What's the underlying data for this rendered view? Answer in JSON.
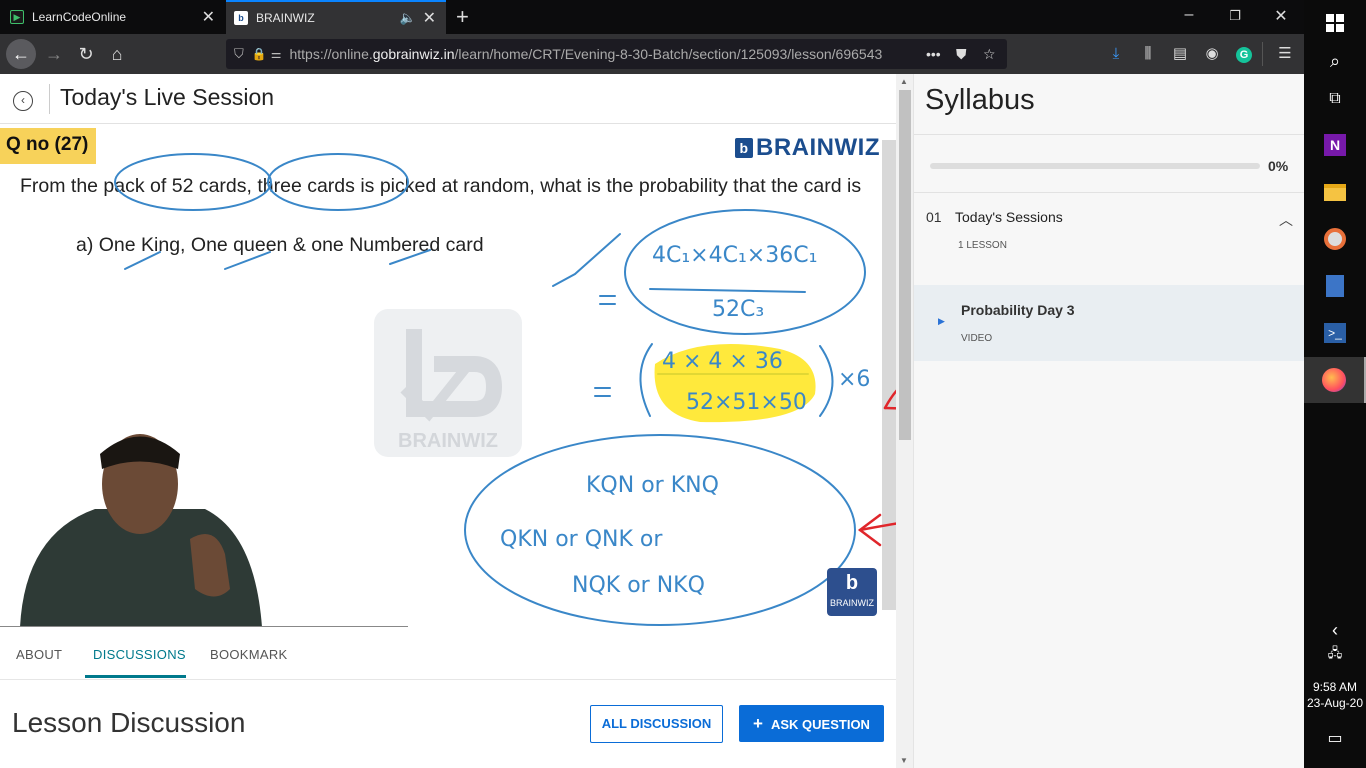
{
  "browser": {
    "tabs": [
      {
        "title": "LearnCodeOnline",
        "active": false
      },
      {
        "title": "BRAINWIZ",
        "active": true
      }
    ],
    "url_prefix": "https://online.",
    "url_domain": "gobrainwiz.in",
    "url_path": "/learn/home/CRT/Evening-8-30-Batch/section/125093/lesson/696543",
    "url_more": "•••"
  },
  "page": {
    "title": "Today's Live Session"
  },
  "video": {
    "question_label": "Q no (27)",
    "brand": "BRAINWIZ",
    "brand_initial": "b",
    "question_text": "From the pack of 52 cards, three cards is picked at random, what is the probability that the card is",
    "option_a": "a) One King, One queen & one Numbered card",
    "watermark_text": "BRAINWIZ",
    "mini_logo_text": "BRAINWIZ"
  },
  "tabs": [
    {
      "label": "ABOUT"
    },
    {
      "label": "DISCUSSIONS"
    },
    {
      "label": "BOOKMARK"
    }
  ],
  "discussion": {
    "heading": "Lesson Discussion",
    "all_button": "ALL DISCUSSION",
    "ask_button": "ASK QUESTION",
    "ask_icon": "+"
  },
  "syllabus": {
    "title": "Syllabus",
    "progress_percent": 0,
    "progress_label": "0%",
    "section": {
      "number": "01",
      "title": "Today's Sessions",
      "count": "1 LESSON"
    },
    "lesson": {
      "title": "Probability Day 3",
      "type": "VIDEO"
    }
  },
  "taskbar": {
    "time": "9:58 AM",
    "date": "23-Aug-20"
  },
  "colors": {
    "accent": "#00798c",
    "primary_button": "#0a6cd7",
    "brand": "#1b4d8e",
    "question_label_bg": "#f7d25a"
  }
}
